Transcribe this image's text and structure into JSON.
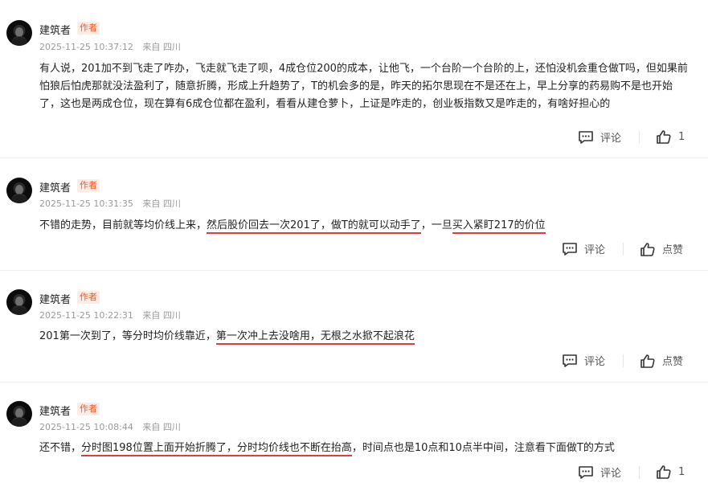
{
  "posts": [
    {
      "author": "建筑者",
      "badge": "作者",
      "time": "2025-11-25 10:37:12",
      "location": "来自 四川",
      "segments": [
        {
          "t": "有人说，201加不到飞走了咋办，飞走就飞走了呗，4成仓位200的成本，让他飞，一个台阶一个台阶的上，还怕没机会重仓做T吗，但如果前怕狼后怕虎那就没法盈利了，随意折腾，形成上升趋势了，T的机会多的是，昨天的拓尔思现在不是还在上，早上分享的药易购不是也开始了，这也是两成仓位，现在算有6成仓位都在盈利，看看从建仓萝卜，上证是咋走的，创业板指数又是咋走的，有啥好担心的",
          "u": false
        }
      ],
      "comment_label": "评论",
      "like_label": "1"
    },
    {
      "author": "建筑者",
      "badge": "作者",
      "time": "2025-11-25 10:31:35",
      "location": "来自 四川",
      "segments": [
        {
          "t": "不错的走势，目前就等均价线上来，",
          "u": false
        },
        {
          "t": "然后股价回去一次201了，做T的就可以动手了",
          "u": true
        },
        {
          "t": "，一旦",
          "u": false
        },
        {
          "t": "买入紧盯217的价位",
          "u": true
        }
      ],
      "comment_label": "评论",
      "like_label": "点赞"
    },
    {
      "author": "建筑者",
      "badge": "作者",
      "time": "2025-11-25 10:22:31",
      "location": "来自 四川",
      "segments": [
        {
          "t": "201第一次到了，等分时均价线靠近，",
          "u": false
        },
        {
          "t": "第一次冲上去没啥用，无根之水掀不起浪花",
          "u": true
        }
      ],
      "comment_label": "评论",
      "like_label": "点赞"
    },
    {
      "author": "建筑者",
      "badge": "作者",
      "time": "2025-11-25 10:08:44",
      "location": "来自 四川",
      "segments": [
        {
          "t": "还不错，",
          "u": false
        },
        {
          "t": "分时图198位置上面开始折腾了，分时均价线也不断在抬高",
          "u": true
        },
        {
          "t": "，时间点也是10点和10点半中间，注意看下面做T的方式",
          "u": false
        }
      ],
      "comment_label": "评论",
      "like_label": "1"
    }
  ],
  "icons": {
    "comment": "comment-icon",
    "like": "thumbs-up-icon"
  },
  "colors": {
    "badge": "#f05a28",
    "underline": "#e33b43",
    "meta": "#999999"
  }
}
